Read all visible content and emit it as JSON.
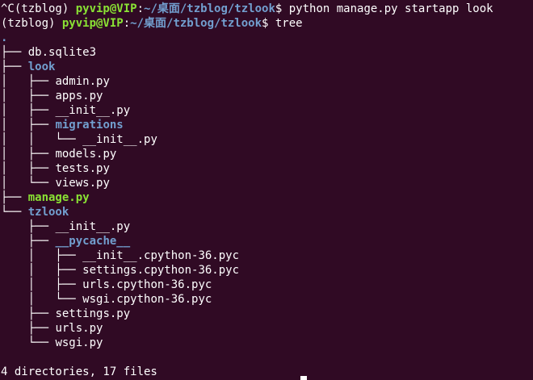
{
  "terminal": {
    "prompt1": {
      "prefix": "^C(tzblog) ",
      "user": "pyvip@VIP",
      "sep": ":",
      "path": "~/桌面/tzblog/tzlook",
      "dollar": "$ ",
      "command": "python manage.py startapp look"
    },
    "prompt2": {
      "prefix": "(tzblog) ",
      "user": "pyvip@VIP",
      "sep": ":",
      "path": "~/桌面/tzblog/tzlook",
      "dollar": "$ ",
      "command": "tree"
    },
    "tree": {
      "root": ".",
      "entries": [
        {
          "prefix": "├── ",
          "name": "db.sqlite3",
          "kind": "file"
        },
        {
          "prefix": "├── ",
          "name": "look",
          "kind": "dir"
        },
        {
          "prefix": "│   ├── ",
          "name": "admin.py",
          "kind": "file"
        },
        {
          "prefix": "│   ├── ",
          "name": "apps.py",
          "kind": "file"
        },
        {
          "prefix": "│   ├── ",
          "name": "__init__.py",
          "kind": "file"
        },
        {
          "prefix": "│   ├── ",
          "name": "migrations",
          "kind": "dir"
        },
        {
          "prefix": "│   │   └── ",
          "name": "__init__.py",
          "kind": "file"
        },
        {
          "prefix": "│   ├── ",
          "name": "models.py",
          "kind": "file"
        },
        {
          "prefix": "│   ├── ",
          "name": "tests.py",
          "kind": "file"
        },
        {
          "prefix": "│   └── ",
          "name": "views.py",
          "kind": "file"
        },
        {
          "prefix": "├── ",
          "name": "manage.py",
          "kind": "exec"
        },
        {
          "prefix": "└── ",
          "name": "tzlook",
          "kind": "dir"
        },
        {
          "prefix": "    ├── ",
          "name": "__init__.py",
          "kind": "file"
        },
        {
          "prefix": "    ├── ",
          "name": "__pycache__",
          "kind": "dir"
        },
        {
          "prefix": "    │   ├── ",
          "name": "__init__.cpython-36.pyc",
          "kind": "file"
        },
        {
          "prefix": "    │   ├── ",
          "name": "settings.cpython-36.pyc",
          "kind": "file"
        },
        {
          "prefix": "    │   ├── ",
          "name": "urls.cpython-36.pyc",
          "kind": "file"
        },
        {
          "prefix": "    │   └── ",
          "name": "wsgi.cpython-36.pyc",
          "kind": "file"
        },
        {
          "prefix": "    ├── ",
          "name": "settings.py",
          "kind": "file"
        },
        {
          "prefix": "    ├── ",
          "name": "urls.py",
          "kind": "file"
        },
        {
          "prefix": "    └── ",
          "name": "wsgi.py",
          "kind": "file"
        }
      ],
      "summary": "4 directories, 17 files"
    }
  },
  "colors": {
    "background": "#300a24",
    "user": "#8ae234",
    "path": "#729fcf",
    "directory": "#729fcf",
    "executable": "#8ae234",
    "text": "#ffffff"
  }
}
